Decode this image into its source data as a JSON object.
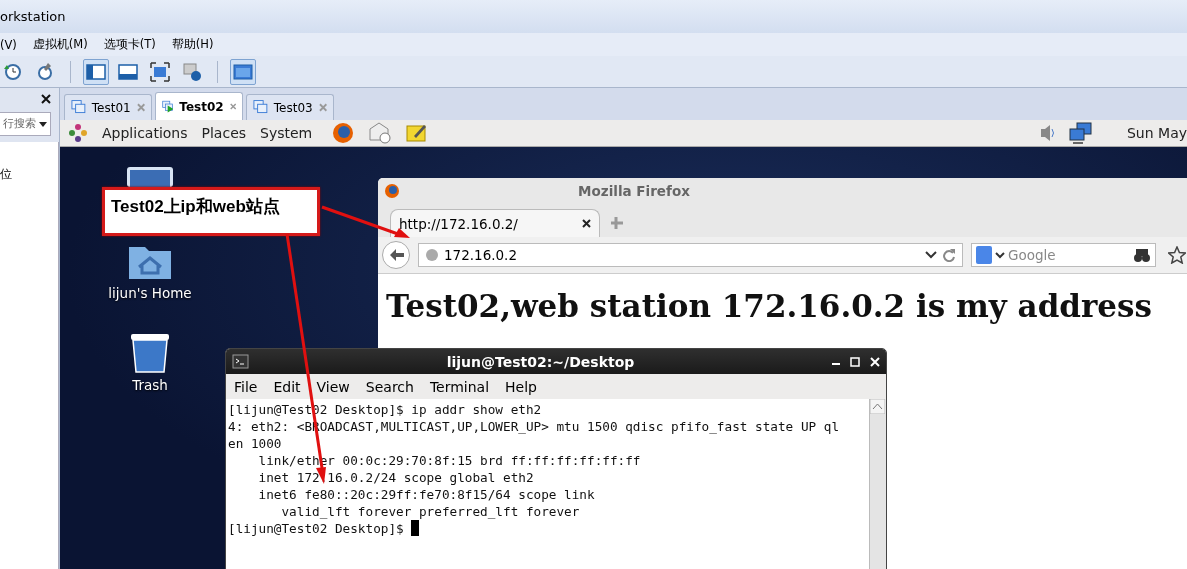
{
  "window": {
    "title": "orkstation"
  },
  "menu": [
    "(V)",
    "虚拟机(M)",
    "选项卡(T)",
    "帮助(H)"
  ],
  "toolbar": [
    {
      "kind": "revert",
      "selected": false
    },
    {
      "kind": "manage",
      "selected": false
    },
    {
      "kind": "sidebar",
      "selected": true
    },
    {
      "kind": "thumbs",
      "selected": false
    },
    {
      "kind": "fullscreen",
      "selected": false
    },
    {
      "kind": "summary",
      "selected": false
    },
    {
      "kind": "console",
      "selected": true
    }
  ],
  "library": {
    "placeholder": "行搜索",
    "items": [
      "位"
    ]
  },
  "vm_tabs": [
    {
      "label": "Test01",
      "selected": false
    },
    {
      "label": "Test02",
      "selected": true
    },
    {
      "label": "Test03",
      "selected": false
    }
  ],
  "guest": {
    "panel": {
      "menus": [
        "Applications",
        "Places",
        "System"
      ],
      "clock": "Sun May"
    },
    "desktop_icons": [
      {
        "kind": "computer"
      },
      {
        "kind": "home",
        "label": "lijun's Home"
      },
      {
        "kind": "trash",
        "label": "Trash"
      }
    ]
  },
  "firefox": {
    "title": "Mozilla Firefox",
    "tab": "http://172.16.0.2/",
    "url": "172.16.0.2",
    "search_placeholder": "Google",
    "heading": "Test02,web station 172.16.0.2 is my address"
  },
  "terminal": {
    "title": "lijun@Test02:~/Desktop",
    "menu": [
      "File",
      "Edit",
      "View",
      "Search",
      "Terminal",
      "Help"
    ],
    "lines": [
      "[lijun@Test02 Desktop]$ ip addr show eth2",
      "4: eth2: <BROADCAST,MULTICAST,UP,LOWER_UP> mtu 1500 qdisc pfifo_fast state UP ql",
      "en 1000",
      "    link/ether 00:0c:29:70:8f:15 brd ff:ff:ff:ff:ff:ff",
      "    inet 172.16.0.2/24 scope global eth2",
      "    inet6 fe80::20c:29ff:fe70:8f15/64 scope link",
      "       valid_lft forever preferred_lft forever",
      "[lijun@Test02 Desktop]$ "
    ]
  },
  "callout": {
    "text": "Test02上ip和web站点"
  }
}
